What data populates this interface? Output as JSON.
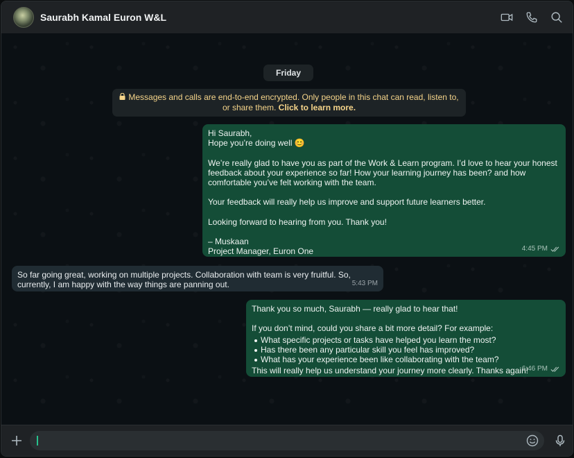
{
  "header": {
    "title": "Saurabh Kamal Euron W&L",
    "icons": [
      "video-call-icon",
      "voice-call-icon",
      "search-icon"
    ]
  },
  "chat": {
    "date_pill": "Friday",
    "encryption_notice": "Messages and calls are end-to-end encrypted. Only people in this chat can read, listen to, or share them.",
    "encryption_link": "Click to learn more.",
    "messages": [
      {
        "direction": "outgoing",
        "text": "Hi Saurabh,\nHope you’re doing well 😊\n\nWe’re really glad to have you as part of the Work & Learn program. I’d love to hear your honest feedback about your experience so far! How your learning journey has been? and how comfortable you’ve felt working with the team.\n\nYour feedback will really help us improve and support future learners better.\n\nLooking forward to hearing from you. Thank you!\n\n– Muskaan\nProject Manager, Euron One",
        "time": "4:45 PM",
        "status": "read"
      },
      {
        "direction": "incoming",
        "text": "So far going great, working on multiple projects. Collaboration with team is very fruitful. So, currently, I am happy with the way things are panning out.",
        "time": "5:43 PM"
      },
      {
        "direction": "outgoing",
        "intro": "Thank you so much, Saurabh — really glad to hear that!\n\nIf you don’t mind, could you share a bit more detail? For example:",
        "bullets": [
          "What specific projects or tasks have helped you learn the most?",
          "Has there been any particular skill you feel has improved?",
          "What has your experience been like collaborating with the team?"
        ],
        "outro": "This will really help us understand your journey more clearly. Thanks again!",
        "time": "6:46 PM",
        "status": "read"
      }
    ]
  },
  "composer": {
    "value": "",
    "placeholder": ""
  },
  "colors": {
    "outgoing_bubble": "#144d37",
    "incoming_bubble": "#202c33",
    "encryption_text": "#f5d48a",
    "accent": "#27c28d"
  }
}
